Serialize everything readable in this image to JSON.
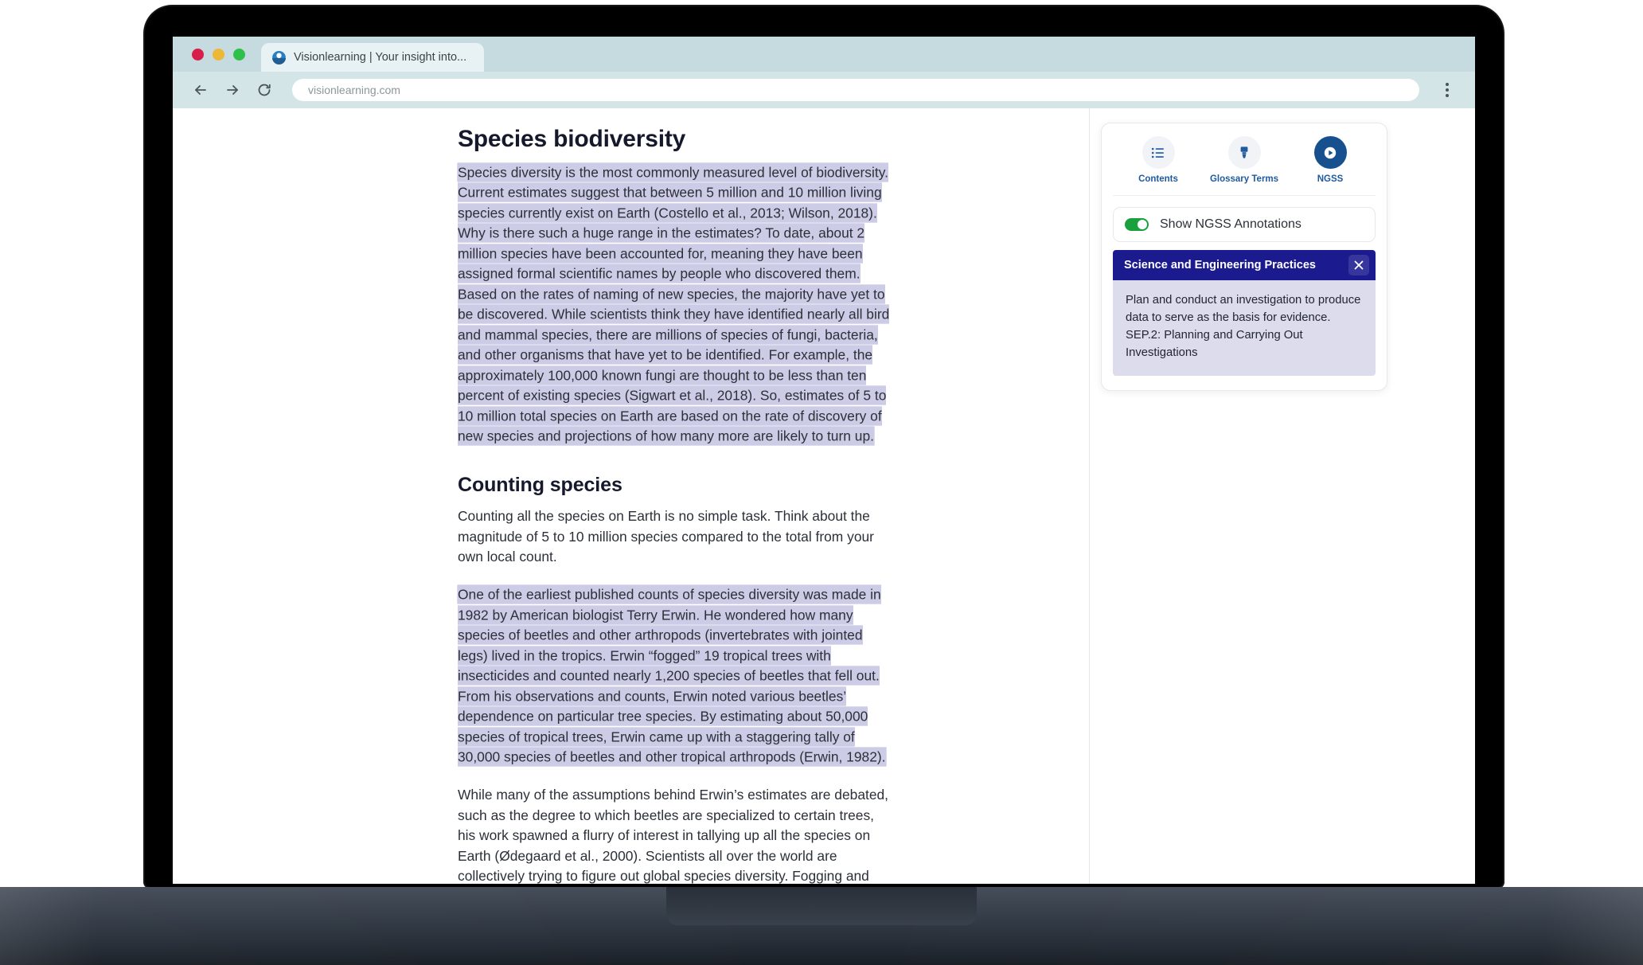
{
  "browser": {
    "tab_title": "Visionlearning | Your insight into...",
    "url": "visionlearning.com",
    "back_icon": "back-arrow-icon",
    "forward_icon": "forward-arrow-icon",
    "reload_icon": "reload-icon",
    "menu_icon": "kebab-menu-icon"
  },
  "article": {
    "title": "Species biodiversity",
    "paragraph_1": "Species diversity is the most commonly measured level of biodiversity. Current estimates suggest that between 5 million and 10 million living species currently exist on Earth (Costello et al., 2013; Wilson, 2018). Why is there such a huge range in the estimates? To date, about 2 million species have been accounted for, meaning they have been assigned formal scientific names by people who discovered them. Based on the rates of naming of new species, the majority have yet to be discovered. While scientists think they have identified nearly all bird and mammal species, there are millions of species of fungi, bacteria, and other organisms that have yet to be identified. For example, the approximately 100,000 known fungi are thought to be less than ten percent of existing species (Sigwart et al., 2018). So, estimates of 5 to 10 million total species on Earth are based on the rate of discovery of new species and projections of how many more are likely to turn up.",
    "section_2_title": "Counting species",
    "paragraph_2": "Counting all the species on Earth is no simple task. Think about the magnitude of 5 to 10 million species compared to the total from your own local count.",
    "paragraph_3": "One of the earliest published counts of species diversity was made in 1982 by American biologist Terry Erwin. He wondered how many species of beetles and other arthropods (invertebrates with jointed legs) lived in the tropics. Erwin “fogged” 19 tropical trees with insecticides and counted nearly 1,200 species of beetles that fell out. From his observations and counts, Erwin noted various beetles’ dependence on particular tree species. By estimating about 50,000 species of tropical trees, Erwin came up with a staggering tally of 30,000 species of beetles and other tropical arthropods (Erwin, 1982).",
    "paragraph_4": "While many of the assumptions behind Erwin’s estimates are debated, such as the degree to which beetles are specialized to certain trees, his work spawned a flurry of interest in tallying up all the species on Earth (Ødegaard et al., 2000). Scientists all over the world are collectively trying to figure out global species diversity. Fogging and other collection techniques are still used today, but judiciously and alongside other methods that are less destructive. For example, insects are sampled by"
  },
  "sidebar": {
    "tools": [
      {
        "label": "Contents",
        "icon": "list-icon",
        "active": false
      },
      {
        "label": "Glossary Terms",
        "icon": "highlighter-pen-icon",
        "active": false
      },
      {
        "label": "NGSS",
        "icon": "play-circle-icon",
        "active": true
      }
    ],
    "toggle_label": "Show NGSS Annotations",
    "toggle_on": true,
    "annotation": {
      "header": "Science and Engineering Practices",
      "close_icon": "close-icon",
      "text": "Plan and conduct an investigation to produce data to serve as the basis for evidence. SEP.2: Planning and Carrying Out Investigations"
    }
  },
  "colors": {
    "chrome": "#c6dbdf",
    "toolbar": "#d4e5e8",
    "highlight": "#ccccE6",
    "accent_blue": "#1f5a9e",
    "ngss_header": "#1b1b8f",
    "ngss_body": "#dcdcec",
    "toggle_green": "#1aa03c"
  }
}
